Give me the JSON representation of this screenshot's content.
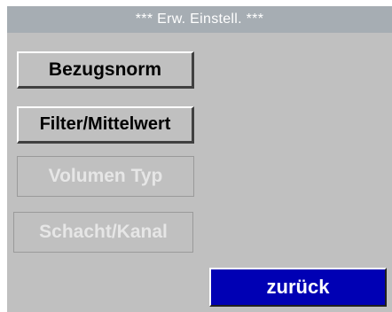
{
  "header": {
    "title": "***   Erw. Einstell. ***"
  },
  "menu": {
    "bezugsnorm_label": "Bezugsnorm",
    "filter_label": "Filter/Mittelwert",
    "volumen_label": "Volumen Typ",
    "schacht_label": "Schacht/Kanal"
  },
  "footer": {
    "back_label": "zurück"
  },
  "colors": {
    "title_bar": "#a6adb3",
    "background": "#c0c0c0",
    "back_button": "#0000b4",
    "disabled_text": "#e6e6e6"
  }
}
